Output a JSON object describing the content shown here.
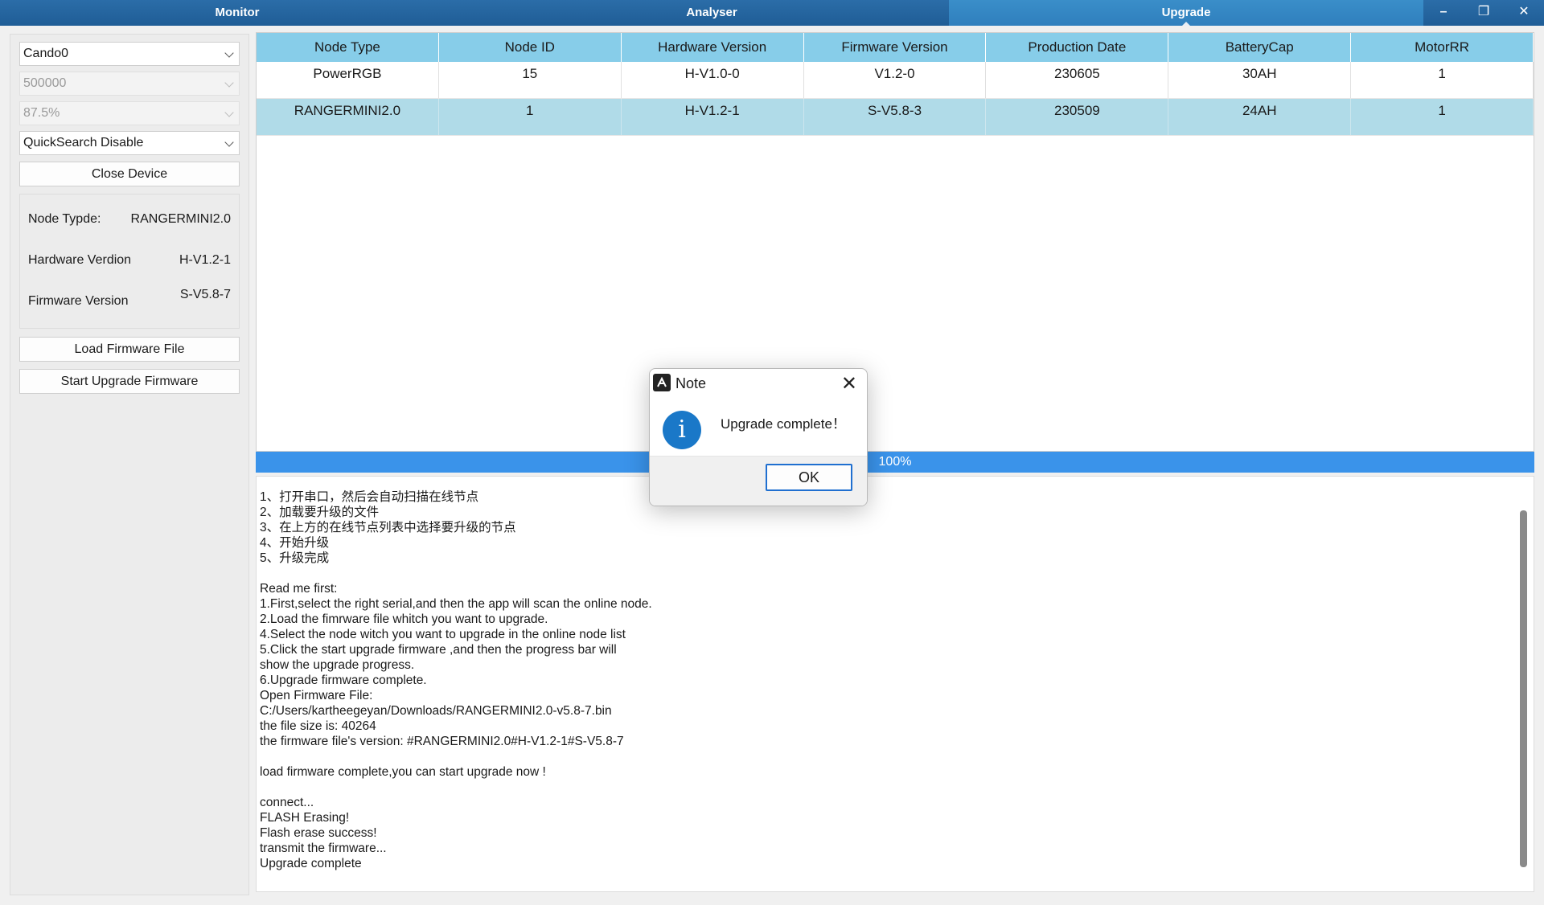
{
  "tabs": [
    {
      "label": "Monitor"
    },
    {
      "label": "Analyser"
    },
    {
      "label": "Upgrade"
    }
  ],
  "window_controls": {
    "minimize": "–",
    "restore": "❐",
    "close": "✕"
  },
  "left": {
    "device_select": "Cando0",
    "baud_select": "500000",
    "sample_select": "87.5%",
    "quicksearch_select": "QuickSearch Disable",
    "close_device_label": "Close Device",
    "info": {
      "node_type_label": "Node Typde:",
      "node_type_value": "RANGERMINI2.0",
      "hw_label": "Hardware Verdion",
      "hw_value": "H-V1.2-1",
      "fw_label": "Firmware Version",
      "fw_value": "S-V5.8-7"
    },
    "load_firmware_label": "Load Firmware File",
    "start_upgrade_label": "Start Upgrade Firmware"
  },
  "table": {
    "headers": [
      "Node Type",
      "Node ID",
      "Hardware Version",
      "Firmware Version",
      "Production Date",
      "BatteryCap",
      "MotorRR"
    ],
    "rows": [
      [
        "PowerRGB",
        "15",
        "H-V1.0-0",
        "V1.2-0",
        "230605",
        "30AH",
        "1"
      ],
      [
        "RANGERMINI2.0",
        "1",
        "H-V1.2-1",
        "S-V5.8-3",
        "230509",
        "24AH",
        "1"
      ]
    ]
  },
  "progress": {
    "value": 1.0,
    "text": "100%"
  },
  "log": [
    "1、打开串口，然后会自动扫描在线节点",
    "2、加载要升级的文件",
    "3、在上方的在线节点列表中选择要升级的节点",
    "4、开始升级",
    "5、升级完成",
    "",
    "Read me first:",
    "1.First,select the right serial,and then the app will scan the online node.",
    "2.Load the fimrware file whitch you want to upgrade.",
    "4.Select the node witch you want to upgrade in the online node list",
    "5.Click the start upgrade firmware ,and then the progress bar will",
    "show the upgrade progress.",
    "6.Upgrade firmware complete.",
    "Open Firmware File:",
    "C:/Users/kartheegeyan/Downloads/RANGERMINI2.0-v5.8-7.bin",
    "the file size is: 40264",
    "the firmware file's version: #RANGERMINI2.0#H-V1.2-1#S-V5.8-7",
    "",
    "load firmware complete,you can start upgrade now !",
    "",
    "connect...",
    "FLASH Erasing!",
    "Flash erase success!",
    "transmit the firmware...",
    "Upgrade complete"
  ],
  "dialog": {
    "title": "Note",
    "close": "✕",
    "message": "Upgrade complete！",
    "ok_label": "OK",
    "icon": "info-icon"
  },
  "colors": {
    "topbar": "#1f5d96",
    "table_header": "#87cde9",
    "selected_row": "#b0dbe8",
    "progress": "#3a93ea"
  }
}
